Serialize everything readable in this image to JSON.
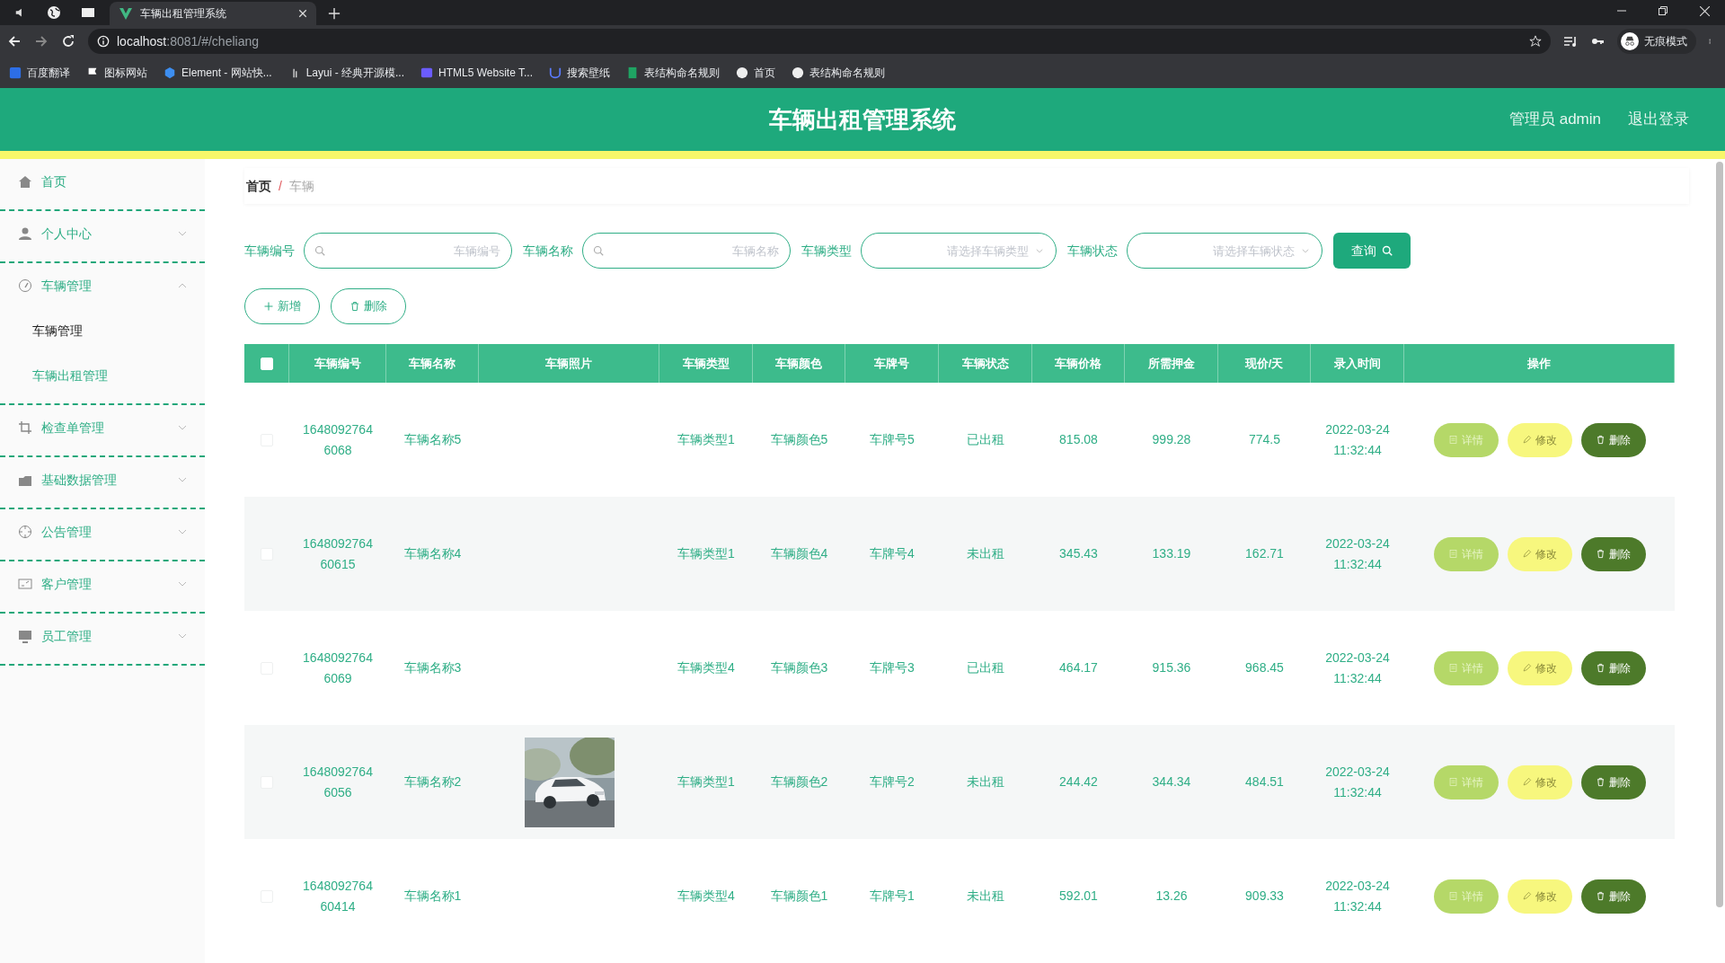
{
  "browser": {
    "tabs": [
      {
        "title": "车辆出租管理系统",
        "selected": true
      }
    ],
    "url": {
      "host": "localhost",
      "path": ":8081/#/cheliang"
    },
    "profile_label": "无痕模式",
    "bookmarks": [
      "百度翻译",
      "图标网站",
      "Element - 网站快...",
      "Layui - 经典开源模...",
      "HTML5 Website T...",
      "搜索壁纸",
      "表结构命名规则",
      "首页",
      "表结构命名规则"
    ]
  },
  "header": {
    "title": "车辆出租管理系统",
    "user": "管理员 admin",
    "logout": "退出登录"
  },
  "sidebar": {
    "items": [
      {
        "label": "首页",
        "kind": "home"
      },
      {
        "label": "个人中心",
        "kind": "person",
        "expanded": false
      },
      {
        "label": "车辆管理",
        "kind": "gauge",
        "expanded": true,
        "children": [
          {
            "label": "车辆管理",
            "selected": true
          },
          {
            "label": "车辆出租管理",
            "selected": false
          }
        ]
      },
      {
        "label": "检查单管理",
        "kind": "crop",
        "expanded": false
      },
      {
        "label": "基础数据管理",
        "kind": "folder",
        "expanded": false
      },
      {
        "label": "公告管理",
        "kind": "target",
        "expanded": false
      },
      {
        "label": "客户管理",
        "kind": "card",
        "expanded": false
      },
      {
        "label": "员工管理",
        "kind": "monitor",
        "expanded": false
      }
    ]
  },
  "breadcrumb": {
    "items": [
      "首页",
      "车辆"
    ],
    "separator": "/"
  },
  "filters": [
    {
      "kind": "input",
      "label": "车辆编号",
      "placeholder": "车辆编号"
    },
    {
      "kind": "input",
      "label": "车辆名称",
      "placeholder": "车辆名称"
    },
    {
      "kind": "select",
      "label": "车辆类型",
      "placeholder": "请选择车辆类型"
    },
    {
      "kind": "select",
      "label": "车辆状态",
      "placeholder": "请选择车辆状态"
    }
  ],
  "search_button": "查询",
  "actions": [
    {
      "kind": "add",
      "label": "新增"
    },
    {
      "kind": "delete",
      "label": "删除"
    }
  ],
  "table": {
    "select_all_checked": false,
    "columns": [
      "车辆编号",
      "车辆名称",
      "车辆照片",
      "车辆类型",
      "车辆颜色",
      "车牌号",
      "车辆状态",
      "车辆价格",
      "所需押金",
      "现价/天",
      "录入时间",
      "操作"
    ],
    "rows": [
      {
        "checked": false,
        "cells": [
          "16480927646068",
          "车辆名称5",
          "",
          "车辆类型1",
          "车辆颜色5",
          "车牌号5",
          "已出租",
          "815.08",
          "999.28",
          "774.5",
          "2022-03-24 11:32:44"
        ],
        "buttons": [
          "详情",
          "修改",
          "删除"
        ]
      },
      {
        "checked": false,
        "cells": [
          "164809276460615",
          "车辆名称4",
          "",
          "车辆类型1",
          "车辆颜色4",
          "车牌号4",
          "未出租",
          "345.43",
          "133.19",
          "162.71",
          "2022-03-24 11:32:44"
        ],
        "buttons": [
          "详情",
          "修改",
          "删除"
        ]
      },
      {
        "checked": false,
        "cells": [
          "16480927646069",
          "车辆名称3",
          "",
          "车辆类型4",
          "车辆颜色3",
          "车牌号3",
          "已出租",
          "464.17",
          "915.36",
          "968.45",
          "2022-03-24 11:32:44"
        ],
        "buttons": [
          "详情",
          "修改",
          "删除"
        ]
      },
      {
        "checked": false,
        "photo": {
          "kind": "picture"
        },
        "cells": [
          "16480927646056",
          "车辆名称2",
          "",
          "车辆类型1",
          "车辆颜色2",
          "车牌号2",
          "未出租",
          "244.42",
          "344.34",
          "484.51",
          "2022-03-24 11:32:44"
        ],
        "buttons": [
          "详情",
          "修改",
          "删除"
        ]
      },
      {
        "checked": false,
        "cells": [
          "164809276460414",
          "车辆名称1",
          "",
          "车辆类型4",
          "车辆颜色1",
          "车牌号1",
          "未出租",
          "592.01",
          "13.26",
          "909.33",
          "2022-03-24 11:32:44"
        ],
        "buttons": [
          "详情",
          "修改",
          "删除"
        ]
      }
    ]
  }
}
